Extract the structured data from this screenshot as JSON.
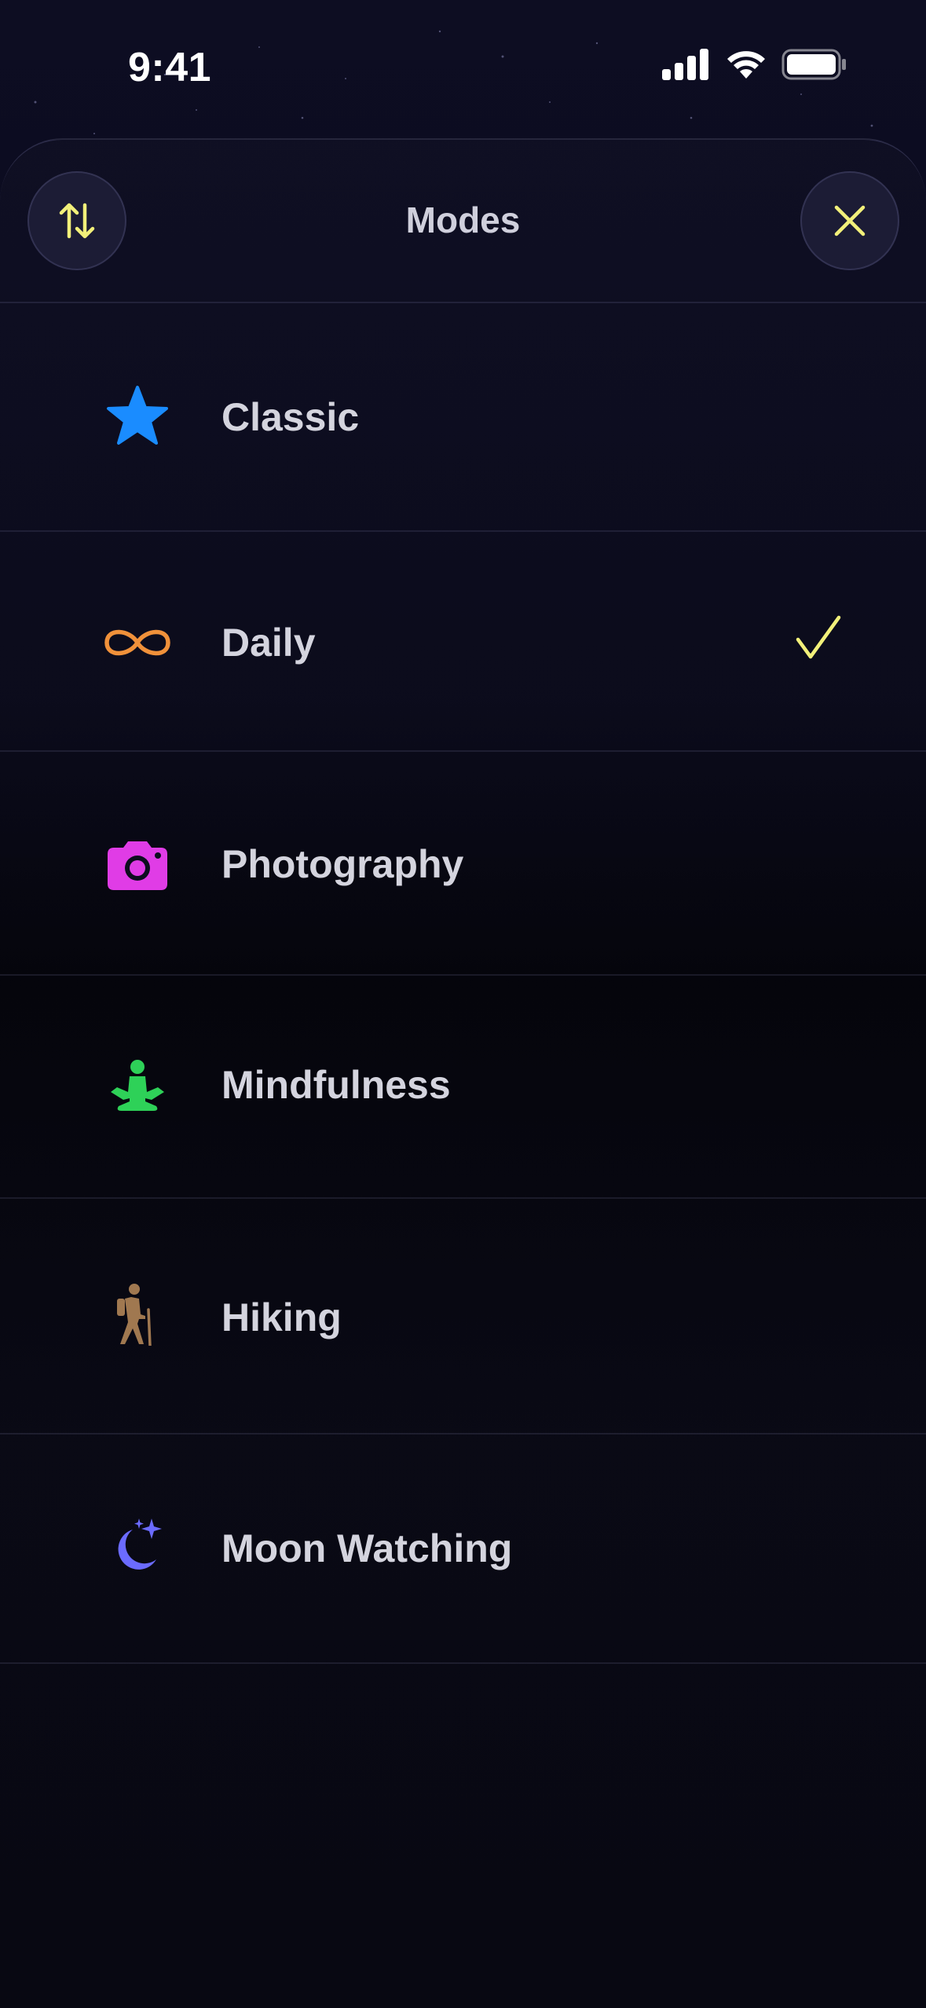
{
  "status_bar": {
    "time": "9:41",
    "icons": [
      "cellular-signal-icon",
      "wifi-icon",
      "battery-icon"
    ]
  },
  "sheet": {
    "title": "Modes",
    "left_button_icon": "sort-arrows-icon",
    "right_button_icon": "close-icon"
  },
  "modes": [
    {
      "label": "Classic",
      "icon": "star-icon",
      "color": "#1a8cff",
      "selected": false
    },
    {
      "label": "Daily",
      "icon": "infinity-icon",
      "color": "#f0913a",
      "selected": true
    },
    {
      "label": "Photography",
      "icon": "camera-icon",
      "color": "#e03ce6",
      "selected": false
    },
    {
      "label": "Mindfulness",
      "icon": "meditation-icon",
      "color": "#2ed158",
      "selected": false
    },
    {
      "label": "Hiking",
      "icon": "hiker-icon",
      "color": "#a07850",
      "selected": false
    },
    {
      "label": "Moon Watching",
      "icon": "moon-stars-icon",
      "color": "#6b6bff",
      "selected": false
    }
  ],
  "colors": {
    "accent": "#f2f07a",
    "background": "#0b0b1a",
    "label": "#d4d4de"
  }
}
